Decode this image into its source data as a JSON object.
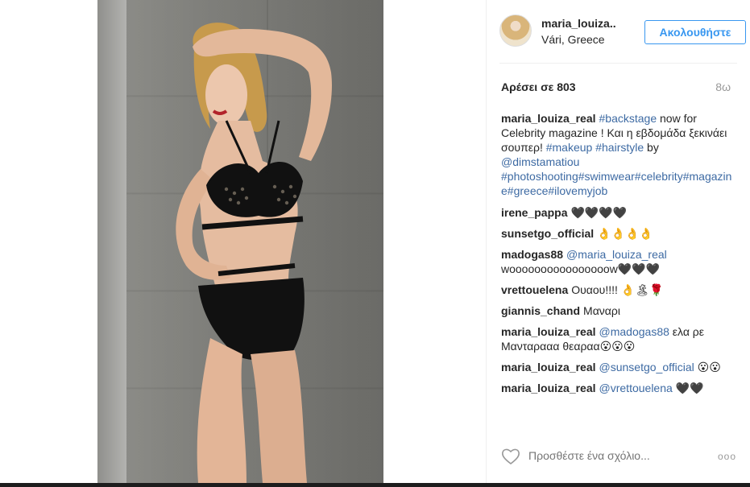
{
  "header": {
    "username": "maria_louiza..",
    "location": "Vári, Greece",
    "follow_label": "Ακολουθήστε"
  },
  "stats": {
    "likes": "Αρέσει σε 803",
    "age": "8ω"
  },
  "caption": {
    "user": "maria_louiza_real",
    "parts": [
      "#backstage",
      " now for Celebrity magazine ! Και η εβδομάδα ξεκινάει σουπερ! ",
      "#makeup",
      " ",
      "#hairstyle",
      " by ",
      "@dimstamatiou",
      " ",
      "#photoshooting",
      "#swimwear",
      "#celebrity",
      "#magazine",
      "#greece",
      "#ilovemyjob"
    ]
  },
  "comments": [
    {
      "user": "irene_pappa",
      "text": "🖤🖤🖤🖤"
    },
    {
      "user": "sunsetgo_official",
      "text": "👌👌👌👌"
    },
    {
      "user": "madogas88",
      "mention": "@maria_louiza_real",
      "text": "woooooooooooooooow🖤🖤🖤"
    },
    {
      "user": "vrettouelena",
      "text": "Ουαου!!!! 👌🏝🌹"
    },
    {
      "user": "giannis_chand",
      "text": "Μαναρι"
    },
    {
      "user": "maria_louiza_real",
      "mention": "@madogas88",
      "text": "ελα ρε Μανταρααα θεαραα😮😮😮"
    },
    {
      "user": "maria_louiza_real",
      "mention": "@sunsetgo_official",
      "text": "😮😮"
    },
    {
      "user": "maria_louiza_real",
      "mention": "@vrettouelena",
      "text": "🖤🖤"
    }
  ],
  "add_comment": {
    "placeholder": "Προσθέστε ένα σχόλιο...",
    "more_label": "ooo"
  },
  "colors": {
    "accent": "#3897f0",
    "link": "#3d6aa3",
    "muted": "#999999"
  },
  "icons": [
    "heart-icon",
    "more-options-icon"
  ]
}
